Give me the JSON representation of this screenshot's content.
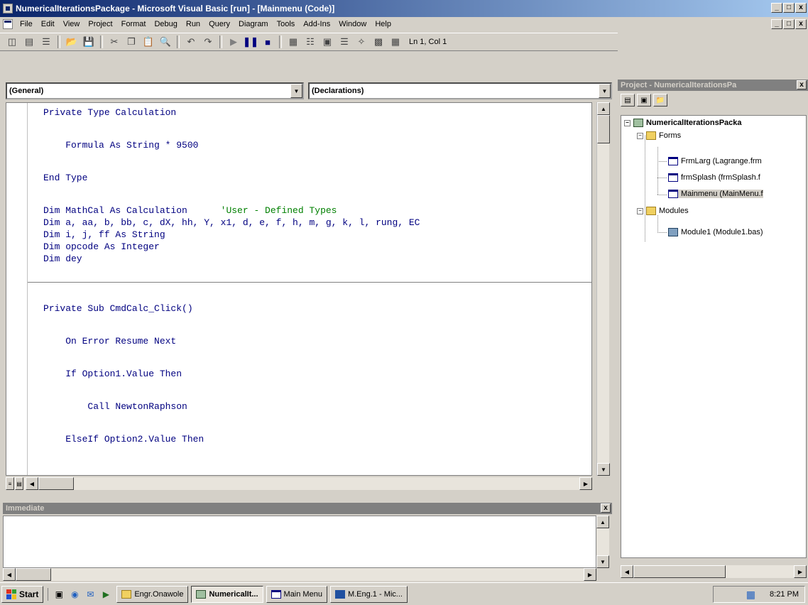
{
  "window": {
    "title": "NumericalIterationsPackage - Microsoft Visual Basic [run] - [Mainmenu (Code)]",
    "min": "_",
    "max": "□",
    "close": "x"
  },
  "menu": [
    "File",
    "Edit",
    "View",
    "Project",
    "Format",
    "Debug",
    "Run",
    "Query",
    "Diagram",
    "Tools",
    "Add-Ins",
    "Window",
    "Help"
  ],
  "toolbar": {
    "position": "Ln 1, Col 1"
  },
  "code_window": {
    "object_combo": "(General)",
    "procedure_combo": "(Declarations)",
    "lines": [
      {
        "text": "Private Type Calculation"
      },
      {
        "text": ""
      },
      {
        "text": "    Formula As String * 9500"
      },
      {
        "text": ""
      },
      {
        "text": "End Type"
      },
      {
        "text": ""
      },
      {
        "text": "Dim MathCal As Calculation      ",
        "comment": "'User - Defined Types"
      },
      {
        "text": "Dim a, aa, b, bb, c, dX, hh, Y, x1, d, e, f, h, m, g, k, l, rung, EC"
      },
      {
        "text": "Dim i, j, ff As String"
      },
      {
        "text": "Dim opcode As Integer"
      },
      {
        "text": "Dim dey"
      },
      {
        "text": ""
      },
      {
        "text": "Private Sub CmdCalc_Click()"
      },
      {
        "text": ""
      },
      {
        "text": "    On Error Resume Next"
      },
      {
        "text": ""
      },
      {
        "text": "    If Option1.Value Then"
      },
      {
        "text": ""
      },
      {
        "text": "        Call NewtonRaphson"
      },
      {
        "text": ""
      },
      {
        "text": "    ElseIf Option2.Value Then"
      }
    ]
  },
  "immediate": {
    "title": "Immediate",
    "close": "x"
  },
  "project_explorer": {
    "title": "Project - NumericalIterationsPa",
    "close": "x",
    "root": "NumericalIterationsPacka",
    "forms_folder": "Forms",
    "forms": [
      "FrmLarg (Lagrange.frm",
      "frmSplash (frmSplash.f",
      "Mainmenu (MainMenu.f"
    ],
    "modules_folder": "Modules",
    "modules": [
      "Module1 (Module1.bas)"
    ]
  },
  "taskbar": {
    "start": "Start",
    "tasks": [
      {
        "label": "Engr.Onawole",
        "active": false
      },
      {
        "label": "NumericalIt...",
        "active": true
      },
      {
        "label": "Main Menu",
        "active": false
      },
      {
        "label": "M.Eng.1 - Mic...",
        "active": false
      }
    ],
    "clock": "8:21 PM"
  }
}
